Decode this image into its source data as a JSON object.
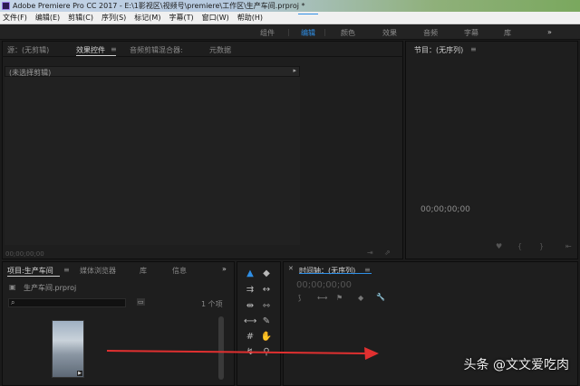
{
  "window": {
    "title": "Adobe Premiere Pro CC 2017 - E:\\1影视区\\视频号\\premiere\\工作区\\生产车间.prproj *"
  },
  "menu": {
    "items": [
      "文件(F)",
      "编辑(E)",
      "剪辑(C)",
      "序列(S)",
      "标记(M)",
      "字幕(T)",
      "窗口(W)",
      "帮助(H)"
    ]
  },
  "workspace": {
    "tabs": [
      "组件",
      "编辑",
      "颜色",
      "效果",
      "音频",
      "字幕",
      "库"
    ],
    "active": "编辑",
    "overflow": "»"
  },
  "source_panel": {
    "tabs": [
      "源：(无剪辑)",
      "效果控件",
      "音频剪辑混合器:",
      "元数据"
    ],
    "menu_glyph": "≡",
    "clip_label": "(未选择剪辑)",
    "timecode": "00;00;00;00"
  },
  "program_panel": {
    "title": "节目：(无序列)",
    "timecode": "00;00;00;00"
  },
  "project_panel": {
    "tabs": [
      "项目:生产车间",
      "媒体浏览器",
      "库",
      "信息"
    ],
    "overflow": "»",
    "file_name": "生产车间.prproj",
    "item_count": "1 个项"
  },
  "timeline_panel": {
    "title": "时间轴：(无序列)",
    "timecode": "00;00;00;00"
  },
  "watermark": "头条 @文文爱吃肉",
  "colors": {
    "accent": "#2f8fe6",
    "arrow": "#e03030"
  }
}
